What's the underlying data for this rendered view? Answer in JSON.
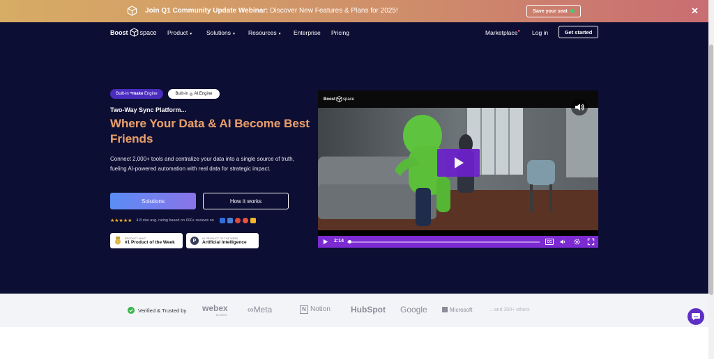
{
  "banner": {
    "title_bold": "Join Q1 Community Update Webinar:",
    "title_rest": " Discover New Features & Plans for 2025!",
    "cta_label": "Save your seat"
  },
  "nav": {
    "logo_part1": "Boost",
    "logo_part2": "space",
    "items": [
      {
        "label": "Product"
      },
      {
        "label": "Solutions"
      },
      {
        "label": "Resources"
      },
      {
        "label": "Enterprise"
      },
      {
        "label": "Pricing"
      }
    ],
    "marketplace_label": "Marketplace",
    "login_label": "Log in",
    "get_started_label": "Get started"
  },
  "hero": {
    "pill_make_prefix": "Built-in",
    "pill_make_brand": "make",
    "pill_make_suffix": "Engine",
    "pill_ai_prefix": "Built-in",
    "pill_ai_suffix": "AI Engine",
    "subtitle": "Two-Way Sync Platform...",
    "headline": "Where Your Data & AI Become Best Friends",
    "description": "Connect 2,000+ tools and centralize your data into a single source of truth, fueling AI-powered automation with real data for strategic impact.",
    "btn_solutions": "Solutions",
    "btn_how": "How it works",
    "rating_text": "4.8 star avg. rating based on 600+ reviews on",
    "badge1_small": "PRODUCT HUNT",
    "badge1_big": "#1 Product of the Week",
    "badge2_small": "#1 PRODUCT OF THE WEEK",
    "badge2_big": "Artificial Intelligence",
    "badge2_letter": "P"
  },
  "video": {
    "logo_part1": "Boost",
    "logo_part2": "space",
    "time": "2:14",
    "cc_label": "CC",
    "progress_fraction": 0.01
  },
  "trust": {
    "label": "Verified & Trusted by",
    "brands": [
      "webex",
      "by CISCO",
      "Meta",
      "Notion",
      "HubSpot",
      "Google",
      "Microsoft"
    ],
    "others": "... and 350+ others"
  },
  "colors": {
    "hero_bg": "#0d0e33",
    "accent_purple": "#7b2bd1",
    "headline_orange": "#e39b68",
    "trust_bg": "#f3f4f8"
  }
}
